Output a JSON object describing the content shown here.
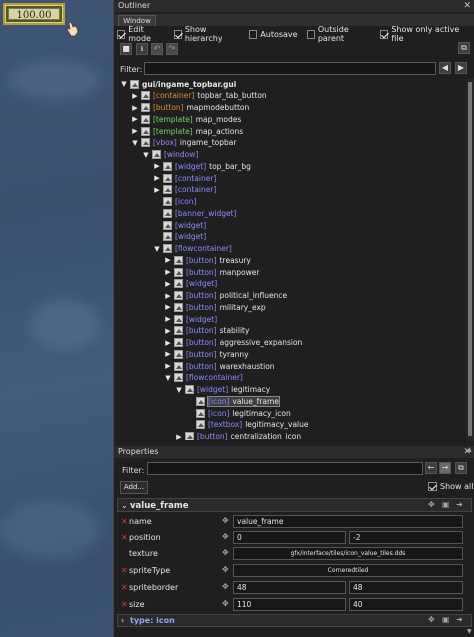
{
  "game": {
    "money": "100.00"
  },
  "outliner": {
    "title": "Outliner",
    "tab": "Window",
    "checkboxes": [
      {
        "label": "Edit mode",
        "checked": true
      },
      {
        "label": "Show hierarchy",
        "checked": true
      },
      {
        "label": "Autosave",
        "checked": false
      },
      {
        "label": "Outside parent",
        "checked": false
      },
      {
        "label": "Show only active file",
        "checked": true
      }
    ],
    "filter_label": "Filter:",
    "filter_value": "",
    "tree": [
      {
        "d": 0,
        "o": "down",
        "tag": "",
        "tc": "",
        "name": "gui/ingame_topbar.gui"
      },
      {
        "d": 1,
        "o": "right",
        "tag": "[container]",
        "tc": "#e08a2a",
        "name": "topbar_tab_button"
      },
      {
        "d": 1,
        "o": "right",
        "tag": "[button]",
        "tc": "#e08a2a",
        "name": "mapmodebutton"
      },
      {
        "d": 1,
        "o": "right",
        "tag": "[template]",
        "tc": "#6fd46f",
        "name": "map_modes"
      },
      {
        "d": 1,
        "o": "right",
        "tag": "[template]",
        "tc": "#6fd46f",
        "name": "map_actions"
      },
      {
        "d": 1,
        "o": "down",
        "tag": "[vbox]",
        "tc": "#8c8cff",
        "name": "ingame_topbar"
      },
      {
        "d": 2,
        "o": "down",
        "tag": "[window]",
        "tc": "#8c8cff",
        "name": ""
      },
      {
        "d": 3,
        "o": "right",
        "tag": "[widget]",
        "tc": "#8c8cff",
        "name": "top_bar_bg"
      },
      {
        "d": 3,
        "o": "right",
        "tag": "[container]",
        "tc": "#8c8cff",
        "name": ""
      },
      {
        "d": 3,
        "o": "right",
        "tag": "[container]",
        "tc": "#8c8cff",
        "name": ""
      },
      {
        "d": 3,
        "o": "",
        "tag": "[icon]",
        "tc": "#8c8cff",
        "name": ""
      },
      {
        "d": 3,
        "o": "",
        "tag": "[banner_widget]",
        "tc": "#8c8cff",
        "name": ""
      },
      {
        "d": 3,
        "o": "",
        "tag": "[widget]",
        "tc": "#8c8cff",
        "name": ""
      },
      {
        "d": 3,
        "o": "",
        "tag": "[widget]",
        "tc": "#8c8cff",
        "name": ""
      },
      {
        "d": 3,
        "o": "down",
        "tag": "[flowcontainer]",
        "tc": "#8c8cff",
        "name": ""
      },
      {
        "d": 4,
        "o": "right",
        "tag": "[button]",
        "tc": "#8c8cff",
        "name": "treasury"
      },
      {
        "d": 4,
        "o": "right",
        "tag": "[button]",
        "tc": "#8c8cff",
        "name": "manpower"
      },
      {
        "d": 4,
        "o": "right",
        "tag": "[widget]",
        "tc": "#8c8cff",
        "name": ""
      },
      {
        "d": 4,
        "o": "right",
        "tag": "[button]",
        "tc": "#8c8cff",
        "name": "political_influence"
      },
      {
        "d": 4,
        "o": "right",
        "tag": "[button]",
        "tc": "#8c8cff",
        "name": "military_exp"
      },
      {
        "d": 4,
        "o": "right",
        "tag": "[widget]",
        "tc": "#8c8cff",
        "name": ""
      },
      {
        "d": 4,
        "o": "right",
        "tag": "[button]",
        "tc": "#8c8cff",
        "name": "stability"
      },
      {
        "d": 4,
        "o": "right",
        "tag": "[button]",
        "tc": "#8c8cff",
        "name": "aggressive_expansion"
      },
      {
        "d": 4,
        "o": "right",
        "tag": "[button]",
        "tc": "#8c8cff",
        "name": "tyranny"
      },
      {
        "d": 4,
        "o": "right",
        "tag": "[button]",
        "tc": "#8c8cff",
        "name": "warexhaustion"
      },
      {
        "d": 4,
        "o": "down",
        "tag": "[flowcontainer]",
        "tc": "#8c8cff",
        "name": ""
      },
      {
        "d": 5,
        "o": "down",
        "tag": "[widget]",
        "tc": "#8c8cff",
        "name": "legitimacy"
      },
      {
        "d": 6,
        "o": "",
        "tag": "[icon]",
        "tc": "#8c8cff",
        "name": "value_frame",
        "sel": true
      },
      {
        "d": 6,
        "o": "",
        "tag": "[icon]",
        "tc": "#8c8cff",
        "name": "legitimacy_icon"
      },
      {
        "d": 6,
        "o": "",
        "tag": "[textbox]",
        "tc": "#8c8cff",
        "name": "legitimacy_value"
      },
      {
        "d": 5,
        "o": "right",
        "tag": "[button]",
        "tc": "#8c8cff",
        "name": "centralization_icon"
      }
    ]
  },
  "properties": {
    "title": "Properties",
    "filter_label": "Filter:",
    "filter_value": "",
    "add_label": "Add...",
    "show_all_label": "Show all",
    "show_all_checked": true,
    "object_name": "value_frame",
    "rows": [
      {
        "name": "name",
        "err": true,
        "v1": "value_frame",
        "v2": null,
        "centered": false
      },
      {
        "name": "position",
        "err": true,
        "v1": "0",
        "v2": "-2",
        "centered": false
      },
      {
        "name": "texture",
        "err": false,
        "v1": "gfx/interface/tiles/icon_value_tiles.dds",
        "v2": null,
        "centered": true
      },
      {
        "name": "spriteType",
        "err": true,
        "v1": "Corneredtiled",
        "v2": null,
        "centered": true
      },
      {
        "name": "spriteborder",
        "err": true,
        "v1": "48",
        "v2": "48",
        "centered": false
      },
      {
        "name": "size",
        "err": true,
        "v1": "110",
        "v2": "40",
        "centered": false
      }
    ],
    "type_section": "type: icon"
  },
  "colors": {
    "panel_bg": "#1f1f1f",
    "header_bg": "#2b2b2b",
    "accent_orange": "#e08a2a",
    "accent_green": "#6fd46f",
    "accent_blue": "#8c8cff",
    "error_red": "#c83c3c"
  }
}
